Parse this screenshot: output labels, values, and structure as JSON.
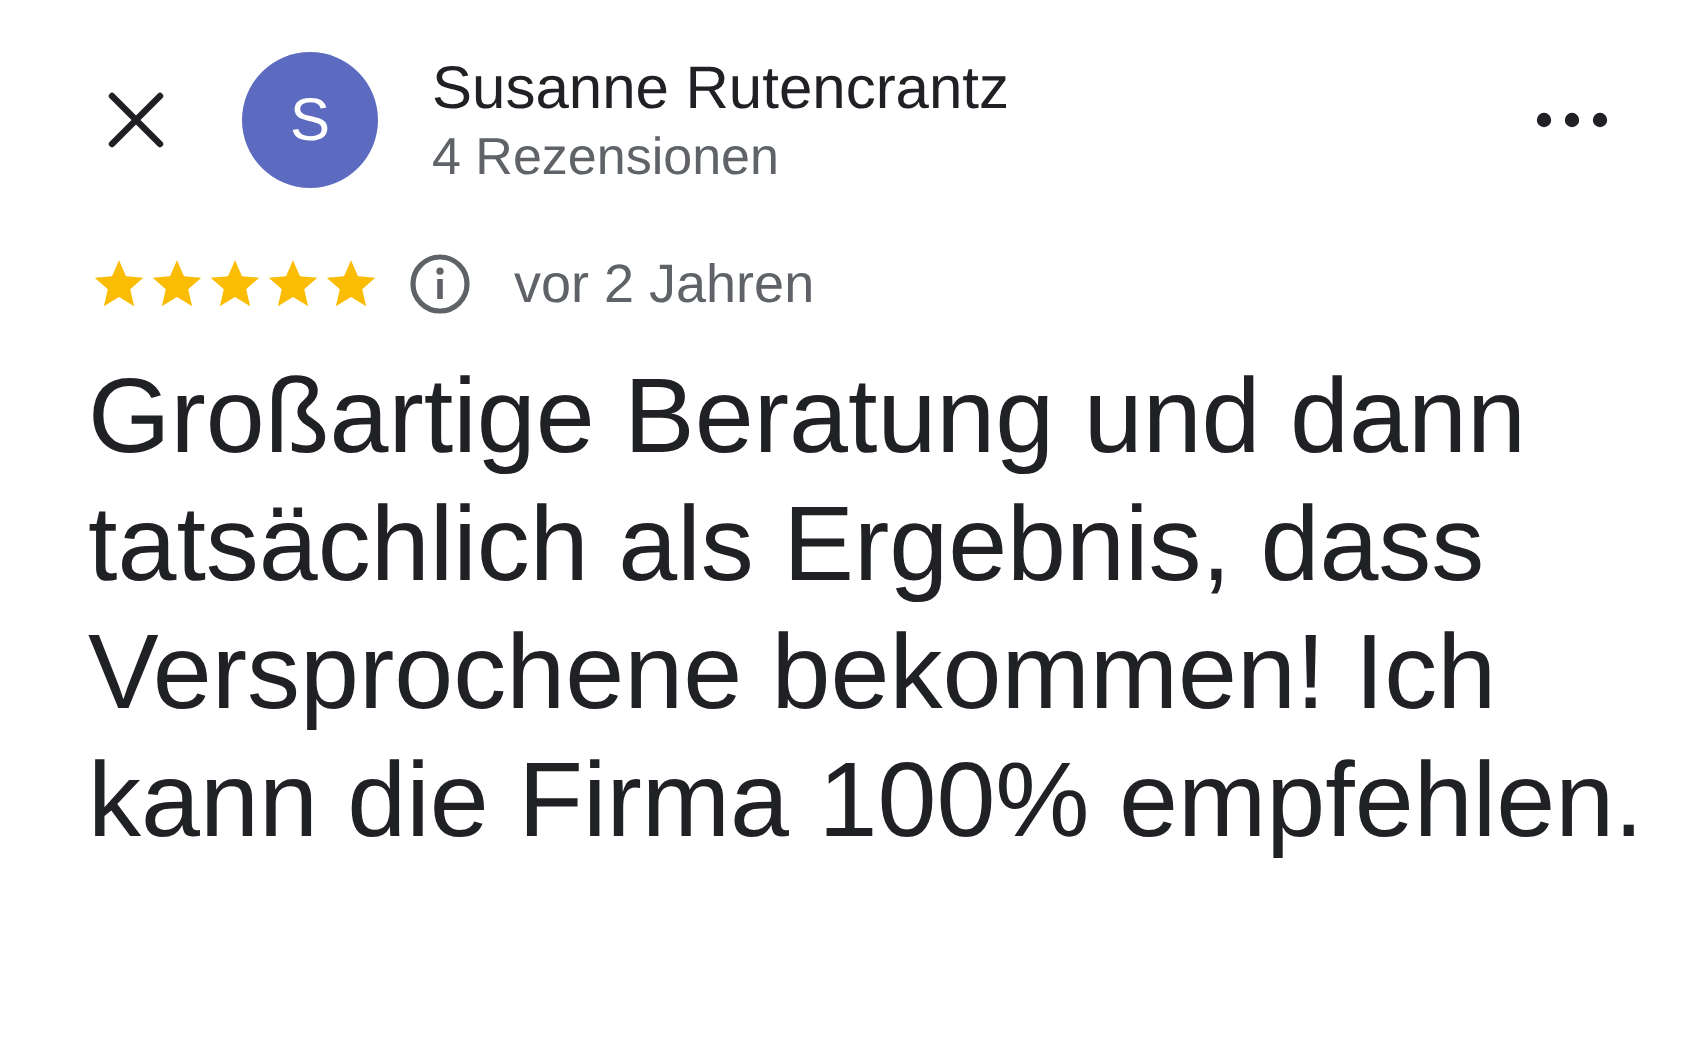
{
  "reviewer": {
    "avatar_letter": "S",
    "name": "Susanne Rutencrantz",
    "review_count": "4 Rezensionen"
  },
  "review": {
    "stars": 5,
    "time": "vor 2 Jahren",
    "text": "Großartige Beratung und dann tatsächlich als Ergebnis, dass Versprochene bekommen! Ich kann die Firma 100% empfehlen."
  }
}
